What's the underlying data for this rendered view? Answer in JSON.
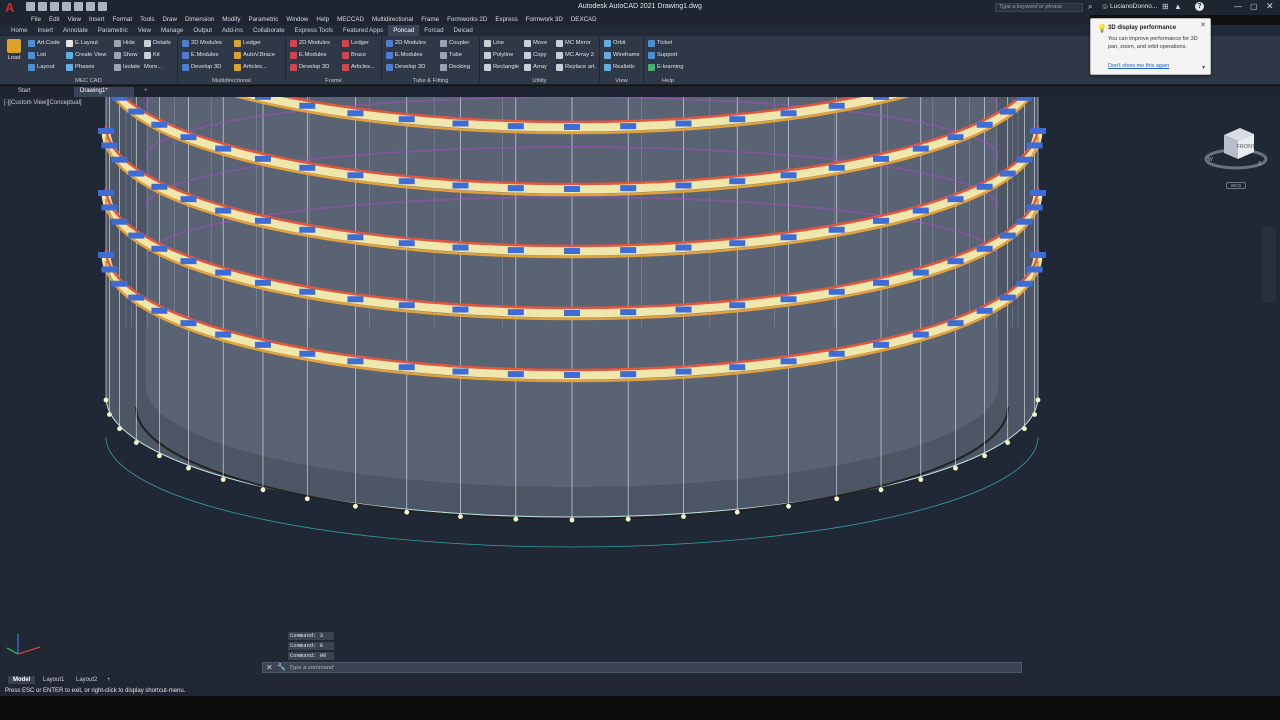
{
  "titlebar": {
    "title": "Autodesk AutoCAD 2021   Drawing1.dwg",
    "search_placeholder": "Type a keyword or phrase",
    "user": "LucianoDonno...",
    "help": "?"
  },
  "menus": [
    "File",
    "Edit",
    "View",
    "Insert",
    "Format",
    "Tools",
    "Draw",
    "Dimension",
    "Modify",
    "Parametric",
    "Window",
    "Help",
    "MECCAD",
    "Multidirectional",
    "Frame",
    "Formworks 2D",
    "Express",
    "Formwork 3D",
    "DEXCAD"
  ],
  "ribbon_tabs": [
    "Home",
    "Insert",
    "Annotate",
    "Parametric",
    "View",
    "Manage",
    "Output",
    "Add-ins",
    "Collaborate",
    "Express Tools",
    "Featured Apps",
    "Poncad",
    "Forcad",
    "Deicad"
  ],
  "active_tab": "Poncad",
  "ribbon": {
    "load": "Load",
    "mec_cad": {
      "label": "MEC CAD",
      "items": [
        "Art.Code",
        "Hide",
        "Details",
        "List",
        "Create View",
        "Kit",
        "Layout",
        "Phases",
        "Isolate",
        "Show",
        "More..."
      ]
    },
    "multidirectional": {
      "label": "Multidirectional",
      "items": [
        "2D Modules",
        "Ledger",
        "E.Modules",
        "AutoV.Brace",
        "Develop 3D",
        "Articles..."
      ]
    },
    "frame": {
      "label": "Frame",
      "items": [
        "2D Modules",
        "Ledger",
        "E.Modules",
        "Brace",
        "Develop 3D",
        "Articles..."
      ]
    },
    "tube_fitting": {
      "label": "Tube & Fitting",
      "items": [
        "2D Modules",
        "Coupler",
        "E.Modules",
        "Tube",
        "Develop 3D",
        "Decking"
      ]
    },
    "utility": {
      "label": "Utility",
      "items": [
        "Line",
        "Move",
        "MC Mirror",
        "Polyline",
        "Copy",
        "MC Array 2",
        "Rectangle",
        "Array",
        "Replace art."
      ]
    },
    "view": {
      "label": "View",
      "items": [
        "Orbit",
        "Wireframe",
        "Realistic"
      ]
    },
    "help": {
      "label": "Help",
      "items": [
        "Ticket",
        "Support",
        "E-learning"
      ]
    }
  },
  "doc_tabs": [
    "Start",
    "Drawing1*"
  ],
  "viewport": {
    "label": "[-][Custom View][Conceptual]",
    "viewcube_face": "FRONT",
    "wcs": "WCS"
  },
  "command": {
    "history": [
      "Command: 3",
      "Command: 6",
      "Command: 00"
    ],
    "placeholder": "Type a command"
  },
  "layout_tabs": [
    "Model",
    "Layout1",
    "Layout2"
  ],
  "status_text": "Press ESC or ENTER to exit, or right-click to display shortcut-menu.",
  "notification": {
    "title": "3D display performance",
    "body": "You can improve performance for 3D pan, zoom, and orbit operations.",
    "link": "Don't show me this again"
  },
  "colors": {
    "viewport_bg": "#202835",
    "ledger_red": "#e0563f",
    "ledger_orange": "#e3a13c",
    "deck_yellow": "#f0e7ad",
    "deck_blue": "#3d6cd6",
    "accent_magenta": "#b34ad0"
  }
}
